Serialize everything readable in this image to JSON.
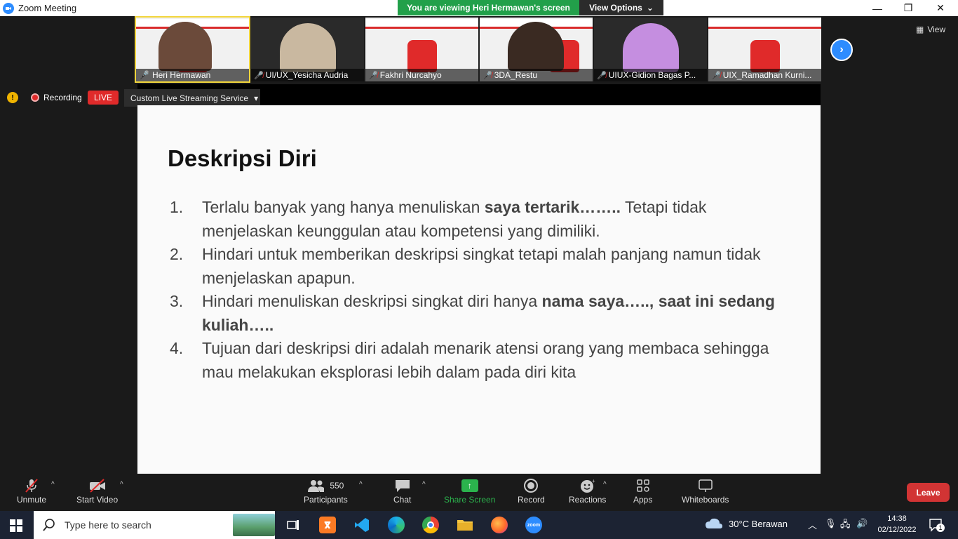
{
  "window": {
    "title": "Zoom Meeting",
    "minimize": "—",
    "restore": "❐",
    "close": "✕"
  },
  "banner": {
    "text": "You are viewing Heri Hermawan's screen"
  },
  "view_options": {
    "label": "View Options",
    "caret": "⌄"
  },
  "view_button": {
    "label": "View"
  },
  "participants_strip": [
    {
      "name": "Heri Hermawan",
      "muted": false
    },
    {
      "name": "UI/UX_Yesicha Audria",
      "muted": true
    },
    {
      "name": "Fakhri Nurcahyo",
      "muted": true
    },
    {
      "name": "3DA_Restu",
      "muted": true
    },
    {
      "name": "UIUX-Gidion Bagas P...",
      "muted": true
    },
    {
      "name": "UIX_Ramadhan Kurni...",
      "muted": true
    }
  ],
  "recording": {
    "label": "Recording",
    "live": "LIVE",
    "stream_service": "Custom Live Streaming Service",
    "stream_caret": "▾"
  },
  "slide": {
    "title": "Deskripsi Diri",
    "items": [
      {
        "num": "1.",
        "pre": "Terlalu  banyak yang hanya menuliskan ",
        "bold": "saya tertarik……..",
        "post": " Tetapi  tidak menjelaskan keunggulan atau kompetensi yang dimiliki."
      },
      {
        "num": "2.",
        "pre": "Hindari untuk memberikan deskripsi singkat tetapi malah panjang namun tidak menjelaskan apapun.",
        "bold": "",
        "post": ""
      },
      {
        "num": "3.",
        "pre": "Hindari menuliskan deskripsi singkat diri hanya ",
        "bold": "nama saya….., saat ini sedang kuliah…..",
        "post": ""
      },
      {
        "num": "4.",
        "pre": "Tujuan dari deskripsi diri adalah menarik atensi orang yang membaca sehingga mau melakukan eksplorasi lebih dalam pada diri kita",
        "bold": "",
        "post": ""
      }
    ]
  },
  "toolbar": {
    "unmute": "Unmute",
    "start_video": "Start Video",
    "participants": "Participants",
    "participants_count": "550",
    "chat": "Chat",
    "share_screen": "Share Screen",
    "record": "Record",
    "reactions": "Reactions",
    "apps": "Apps",
    "whiteboards": "Whiteboards",
    "leave": "Leave",
    "caret": "^"
  },
  "taskbar": {
    "search_placeholder": "Type here to search",
    "weather": "30°C  Berawan",
    "time": "14:38",
    "date": "02/12/2022",
    "notification_count": "1"
  },
  "colors": {
    "banner": "#22a04a",
    "live": "#e02a2a",
    "leave": "#d23434",
    "share": "#2bb34d",
    "zoom_blue": "#2d8cff"
  }
}
